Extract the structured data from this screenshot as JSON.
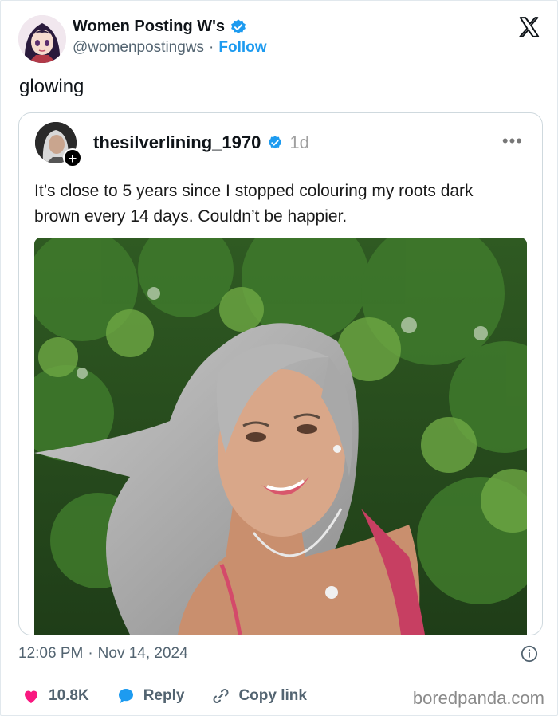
{
  "author": {
    "name": "Women Posting W's",
    "handle": "@womenpostingws",
    "separator": "·",
    "follow_label": "Follow"
  },
  "tweet_text": "glowing",
  "quoted": {
    "username": "thesilverlining_1970",
    "time": "1d",
    "more": "•••",
    "text": "It’s close to 5 years since I stopped colouring my roots dark brown every 14 days. Couldn’t be happier."
  },
  "meta": {
    "time": "12:06 PM",
    "separator": "·",
    "date": "Nov 14, 2024"
  },
  "actions": {
    "likes": "10.8K",
    "reply": "Reply",
    "copy_link": "Copy link"
  },
  "watermark": "boredpanda.com",
  "colors": {
    "accent": "#1d9bf0",
    "heart": "#f91880",
    "text": "#0f1419",
    "muted": "#536471"
  },
  "icons": [
    "verified-badge-icon",
    "x-logo-icon",
    "plus-icon",
    "more-icon",
    "info-icon",
    "heart-icon",
    "reply-bubble-icon",
    "link-icon"
  ]
}
